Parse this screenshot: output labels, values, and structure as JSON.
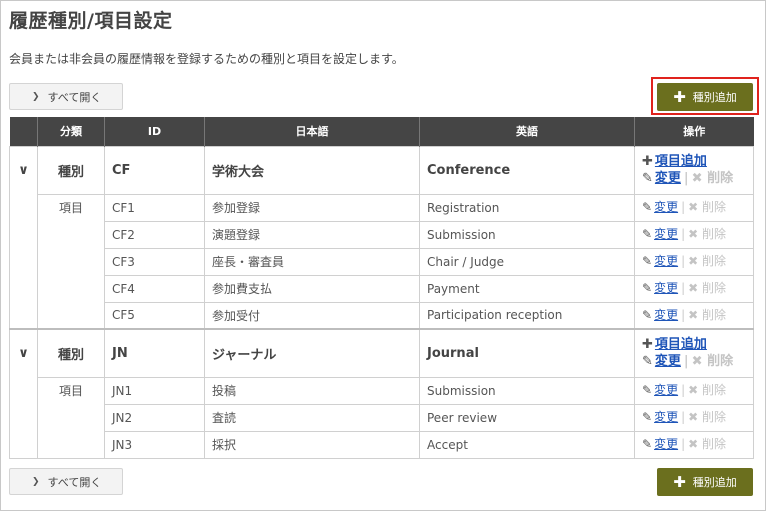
{
  "page": {
    "title": "履歴種別/項目設定",
    "description": "会員または非会員の履歴情報を登録するための種別と項目を設定します。"
  },
  "buttons": {
    "expand_all": "すべて開く",
    "add_type": "種別追加"
  },
  "table": {
    "headers": [
      "",
      "分類",
      "ID",
      "日本語",
      "英語",
      "操作"
    ],
    "operations": {
      "add_item": "項目追加",
      "edit": "変更",
      "delete": "削除"
    },
    "groups": [
      {
        "category": "種別",
        "id": "CF",
        "ja": "学術大会",
        "en": "Conference",
        "item_category": "項目",
        "items": [
          {
            "id": "CF1",
            "ja": "参加登録",
            "en": "Registration"
          },
          {
            "id": "CF2",
            "ja": "演題登録",
            "en": "Submission"
          },
          {
            "id": "CF3",
            "ja": "座長・審査員",
            "en": "Chair / Judge"
          },
          {
            "id": "CF4",
            "ja": "参加費支払",
            "en": "Payment"
          },
          {
            "id": "CF5",
            "ja": "参加受付",
            "en": "Participation reception"
          }
        ]
      },
      {
        "category": "種別",
        "id": "JN",
        "ja": "ジャーナル",
        "en": "Journal",
        "item_category": "項目",
        "items": [
          {
            "id": "JN1",
            "ja": "投稿",
            "en": "Submission"
          },
          {
            "id": "JN2",
            "ja": "査読",
            "en": "Peer review"
          },
          {
            "id": "JN3",
            "ja": "採択",
            "en": "Accept"
          }
        ]
      }
    ]
  },
  "icons": {
    "expand": "chevron-down-icon",
    "open": "chevron-right-icon",
    "add": "plus-icon",
    "edit": "pencil-icon",
    "delete": "x-icon"
  },
  "colors": {
    "accent": "#6b6f1e",
    "header_bg": "#454545",
    "link": "#1f55b8",
    "highlight": "#e0231d",
    "disabled": "#c4c4c4"
  }
}
